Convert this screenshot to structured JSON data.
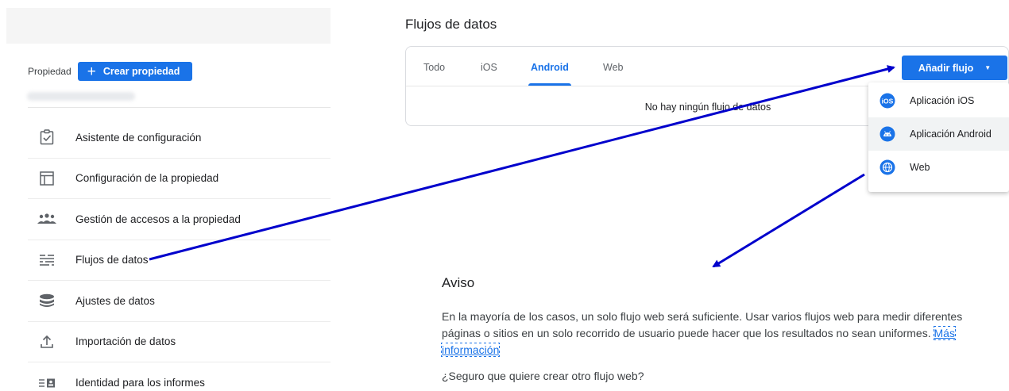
{
  "property": {
    "label": "Propiedad",
    "create_button": "Crear propiedad"
  },
  "nav": {
    "items": [
      {
        "label": "Asistente de configuración",
        "icon": "clipboard-check-icon"
      },
      {
        "label": "Configuración de la propiedad",
        "icon": "layout-icon"
      },
      {
        "label": "Gestión de accesos a la propiedad",
        "icon": "people-icon"
      },
      {
        "label": "Flujos de datos",
        "icon": "data-streams-icon"
      },
      {
        "label": "Ajustes de datos",
        "icon": "database-icon"
      },
      {
        "label": "Importación de datos",
        "icon": "upload-icon"
      },
      {
        "label": "Identidad para los informes",
        "icon": "reporting-identity-icon"
      }
    ]
  },
  "streams": {
    "title": "Flujos de datos",
    "tabs": [
      {
        "label": "Todo"
      },
      {
        "label": "iOS"
      },
      {
        "label": "Android"
      },
      {
        "label": "Web"
      }
    ],
    "active_tab": "Android",
    "empty_message": "No hay ningún flujo de datos",
    "add_button": "Añadir flujo"
  },
  "dropdown": {
    "items": [
      {
        "label": "Aplicación iOS",
        "icon": "ios-icon"
      },
      {
        "label": "Aplicación Android",
        "icon": "android-icon"
      },
      {
        "label": "Web",
        "icon": "globe-icon"
      }
    ]
  },
  "notice": {
    "title": "Aviso",
    "body": "En la mayoría de los casos, un solo flujo web será suficiente. Usar varios flujos web para medir diferentes páginas o sitios en un solo recorrido de usuario puede hacer que los resultados no sean uniformes.",
    "link": "Más información",
    "question": "¿Seguro que quiere crear otro flujo web?"
  },
  "colors": {
    "accent": "#1a73e8",
    "annotation_arrow": "#0000cc"
  }
}
